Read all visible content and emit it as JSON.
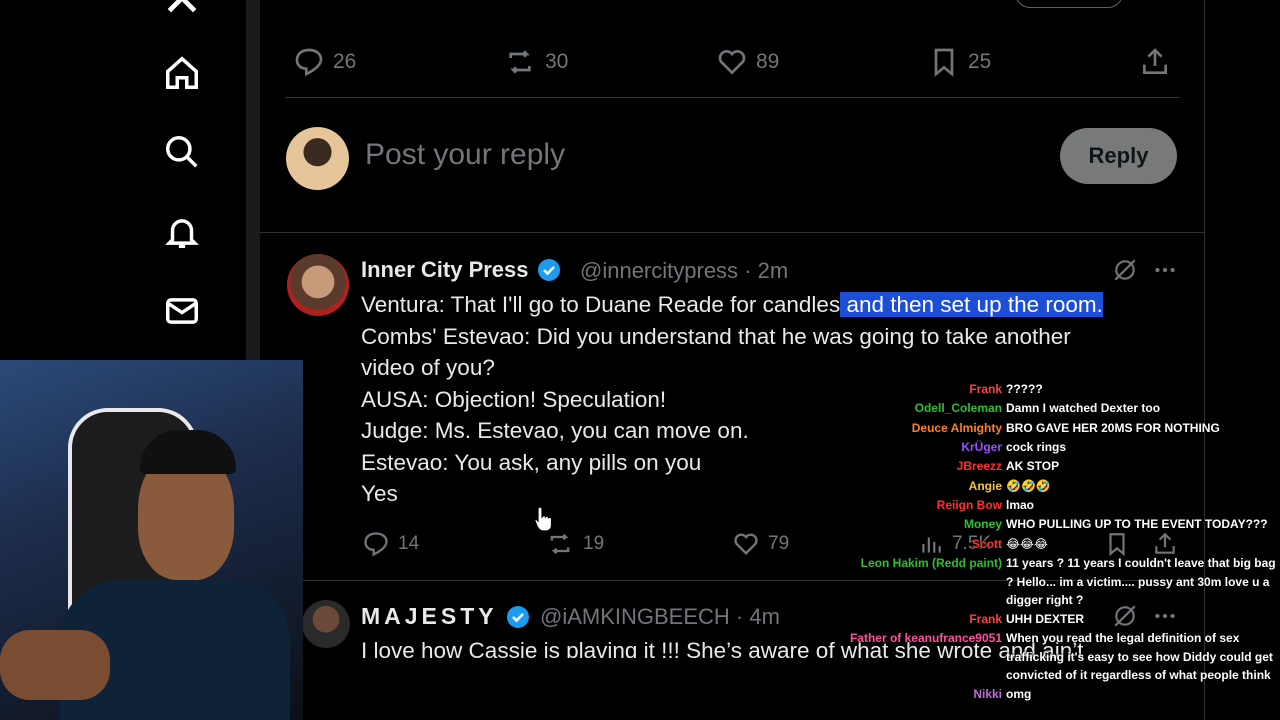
{
  "sidebar": {
    "items": [
      {
        "name": "x-logo-icon"
      },
      {
        "name": "home-icon"
      },
      {
        "name": "search-icon"
      },
      {
        "name": "notifications-icon"
      },
      {
        "name": "messages-icon"
      }
    ]
  },
  "post_actions": {
    "replies": "26",
    "reposts": "30",
    "likes": "89",
    "bookmarks": "25"
  },
  "reply_box": {
    "placeholder": "Post your reply",
    "button_label": "Reply"
  },
  "tweet1": {
    "name": "Inner City Press",
    "handle_time": "@innercitypress · 2m",
    "lines": [
      "Ventura: That I'll go to Duane Reade for candles",
      " and then set up the room.",
      "Combs' Estevao: Did you understand that he was going to take another",
      "video of you?",
      "AUSA: Objection! Speculation!",
      "Judge: Ms. Estevao, you can move on.",
      "Estevao: You ask, any pills on you",
      "Yes"
    ],
    "replies": "14",
    "reposts": "19",
    "likes": "79",
    "views": "7.5K"
  },
  "tweet2": {
    "name": "MAJESTY",
    "handle_time": "@iAMKINGBEECH · 4m",
    "text": "I love how Cassie is plaving it !!! She’s aware of what she wrote and ain’t"
  },
  "chat": [
    {
      "user": "Frank",
      "color": "#ff4040",
      "msg": "?????"
    },
    {
      "user": "Odell_Coleman",
      "color": "#2fbf2f",
      "msg": "Damn I watched Dexter too"
    },
    {
      "user": "Deuce Almighty",
      "color": "#ff7f24",
      "msg": "BRO GAVE HER 20MS FOR NOTHING"
    },
    {
      "user": "KrÜger",
      "color": "#9b4dff",
      "msg": "cock rings"
    },
    {
      "user": "JBreezz",
      "color": "#ff3030",
      "msg": "AK STOP"
    },
    {
      "user": "Angie",
      "color": "#f5c542",
      "msg": "🤣🤣🤣"
    },
    {
      "user": "Reiign Bow",
      "color": "#ff3030",
      "msg": "lmao"
    },
    {
      "user": "Money",
      "color": "#2fbf2f",
      "msg": "WHO PULLING UP TO THE EVENT TODAY???"
    },
    {
      "user": "Scott",
      "color": "#ff3030",
      "msg": "😂😂😂"
    },
    {
      "user": "Leon Hakim (Redd paint)",
      "color": "#2fbf2f",
      "msg": "11 years ? 11 years I couldn't leave that big bag ? Hello... im a victim.... pussy ant 30m love u a digger right ?"
    },
    {
      "user": "Frank",
      "color": "#ff4040",
      "msg": "UHH DEXTER"
    },
    {
      "user": "Father of keanufrance9051",
      "color": "#ff4fa0",
      "msg": "When you read the legal definition of sex trafficking it's easy to see how Diddy could get convicted of it regardless of what people think"
    },
    {
      "user": "Nikki",
      "color": "#c06bd6",
      "msg": "omg"
    }
  ]
}
